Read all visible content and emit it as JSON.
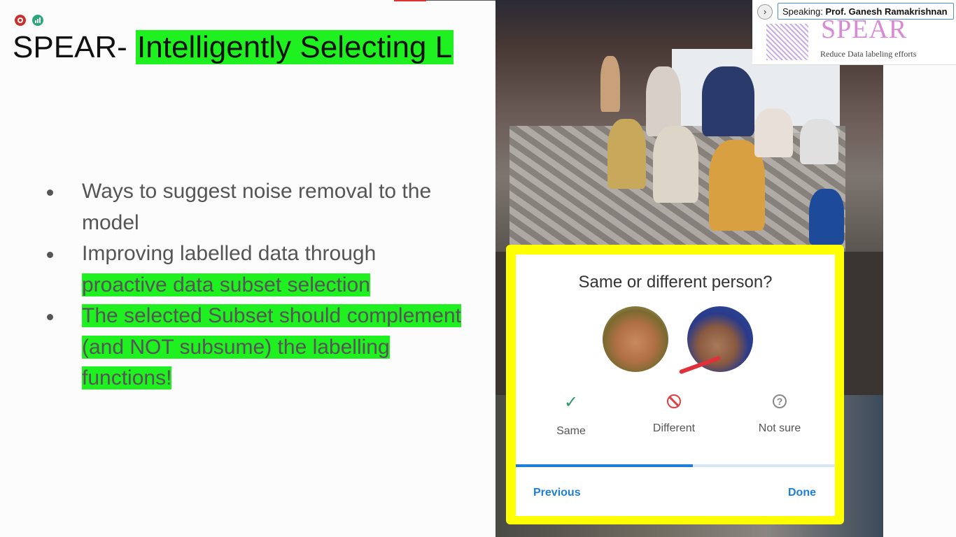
{
  "slide": {
    "title_plain": "SPEAR- ",
    "title_highlight": "Intelligently Selecting L",
    "bullets": [
      {
        "text": "Ways to suggest noise removal to the model",
        "highlight": ""
      },
      {
        "text": "Improving labelled data through ",
        "highlight": "proactive data subset selection"
      },
      {
        "text": "",
        "highlight": "The selected Subset should complement (and NOT subsume) the labelling functions!"
      }
    ],
    "colors": {
      "highlight": "#1ff01f",
      "text": "#555555"
    }
  },
  "speaker": {
    "prefix": "Speaking: ",
    "name": "Prof. Ganesh Ramakrishnan",
    "expand_icon": "chevron-right-icon"
  },
  "spear_banner": {
    "logo": "SPEAR",
    "tagline": "Reduce Data labeling efforts"
  },
  "dialog": {
    "title": "Same or different person?",
    "options": [
      {
        "label": "Same",
        "icon": "check-icon",
        "color": "#2a9a6a"
      },
      {
        "label": "Different",
        "icon": "ban-icon",
        "color": "#e04040"
      },
      {
        "label": "Not sure",
        "icon": "question-icon",
        "color": "#888888"
      }
    ],
    "progress": 0.555,
    "previous_label": "Previous",
    "done_label": "Done",
    "frame_color": "#ffff00",
    "accent": "#1e7fd8"
  },
  "indicators": [
    "record-icon",
    "stats-icon"
  ]
}
